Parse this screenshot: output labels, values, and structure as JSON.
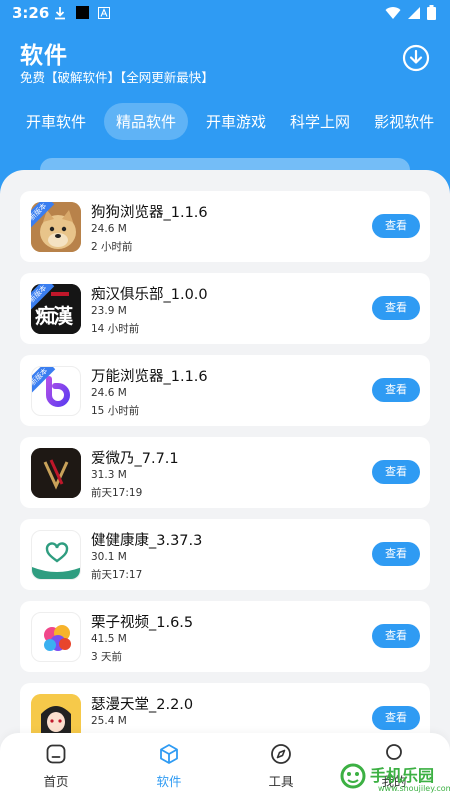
{
  "status_bar": {
    "time": "3:26"
  },
  "header": {
    "title": "软件",
    "subtitle": "免费【破解软件】【全网更新最快】"
  },
  "tabs": [
    {
      "label": "开車软件",
      "active": false
    },
    {
      "label": "精品软件",
      "active": true
    },
    {
      "label": "开車游戏",
      "active": false
    },
    {
      "label": "科学上网",
      "active": false
    },
    {
      "label": "影视软件",
      "active": false
    }
  ],
  "apps": [
    {
      "name": "狗狗浏览器_1.1.6",
      "size": "24.6 M",
      "time": "2 小时前",
      "badge": "新版本",
      "button": "查看",
      "icon": "dog-app-icon"
    },
    {
      "name": "痴汉俱乐部_1.0.0",
      "size": "23.9 M",
      "time": "14 小时前",
      "badge": "新版本",
      "button": "查看",
      "icon": "chihan-app-icon"
    },
    {
      "name": "万能浏览器_1.1.6",
      "size": "24.6 M",
      "time": "15 小时前",
      "badge": "新版本",
      "button": "查看",
      "icon": "wanneng-browser-icon"
    },
    {
      "name": "爱微乃_7.7.1",
      "size": "31.3 M",
      "time": "前天17:19",
      "button": "查看",
      "icon": "aiweinai-app-icon"
    },
    {
      "name": "健健康康_3.37.3",
      "size": "30.1 M",
      "time": "前天17:17",
      "button": "查看",
      "icon": "heart-app-icon"
    },
    {
      "name": "栗子视频_1.6.5",
      "size": "41.5 M",
      "time": "3 天前",
      "button": "查看",
      "icon": "lizi-video-icon"
    },
    {
      "name": "瑟漫天堂_2.2.0",
      "size": "25.4 M",
      "time": "",
      "button": "查看",
      "icon": "anime-girl-icon"
    }
  ],
  "icon_overlay": {
    "chihan": "痴漢"
  },
  "bottom_nav": [
    {
      "label": "首页",
      "icon": "home-icon",
      "active": false
    },
    {
      "label": "软件",
      "icon": "cube-icon",
      "active": true
    },
    {
      "label": "工具",
      "icon": "compass-icon",
      "active": false
    },
    {
      "label": "我的",
      "icon": "user-icon",
      "active": false
    }
  ],
  "watermark": {
    "text": "手机乐园",
    "url": "www.shoujiley.com"
  },
  "colors": {
    "primary": "#2f9bf3",
    "background": "#f2f3f5",
    "badge": "#3a7ef0"
  }
}
